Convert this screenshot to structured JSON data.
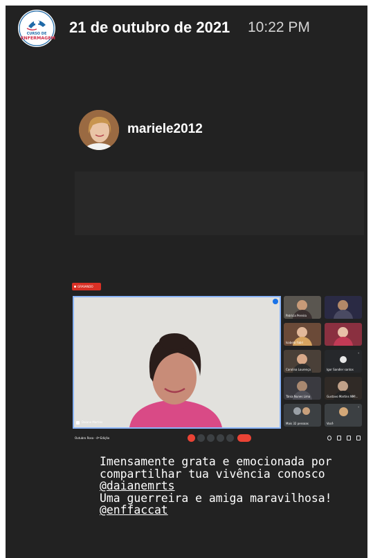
{
  "story": {
    "account_logo": {
      "line1": "CURSO DE",
      "line2": "ENFERMAGEM",
      "colors": {
        "blue": "#1f6aa8",
        "red": "#d02d4a"
      }
    },
    "date": "21 de outubro de 2021",
    "time": "10:22 PM",
    "username": "mariele2012"
  },
  "meeting": {
    "recording_label": "GRAVANDO",
    "main_speaker": "Daiane Martins",
    "participants": [
      {
        "name": "Patrícia Pereira"
      },
      {
        "name": ""
      },
      {
        "name": "Isabela Fabri"
      },
      {
        "name": ""
      },
      {
        "name": "Carolina Lourenço"
      },
      {
        "name": "Igor Sandler santos"
      },
      {
        "name": "Tânia Nunes Lima"
      },
      {
        "name": "Gustavo Martins NMI..."
      },
      {
        "name": "Mais 32 pessoas"
      },
      {
        "name": "Você"
      }
    ],
    "title": "Outubro Rosa - 4ª Edição",
    "colors": {
      "end_call": "#ea4335",
      "active_speaker": "#8ab4f8"
    }
  },
  "caption": {
    "line1": "Imensamente grata e emocionada por",
    "line2": "compartilhar tua vivência conosco",
    "mention1": "@daianemrts",
    "line4": "Uma guerreira e amiga maravilhosa!",
    "mention2": "@enffaccat"
  }
}
